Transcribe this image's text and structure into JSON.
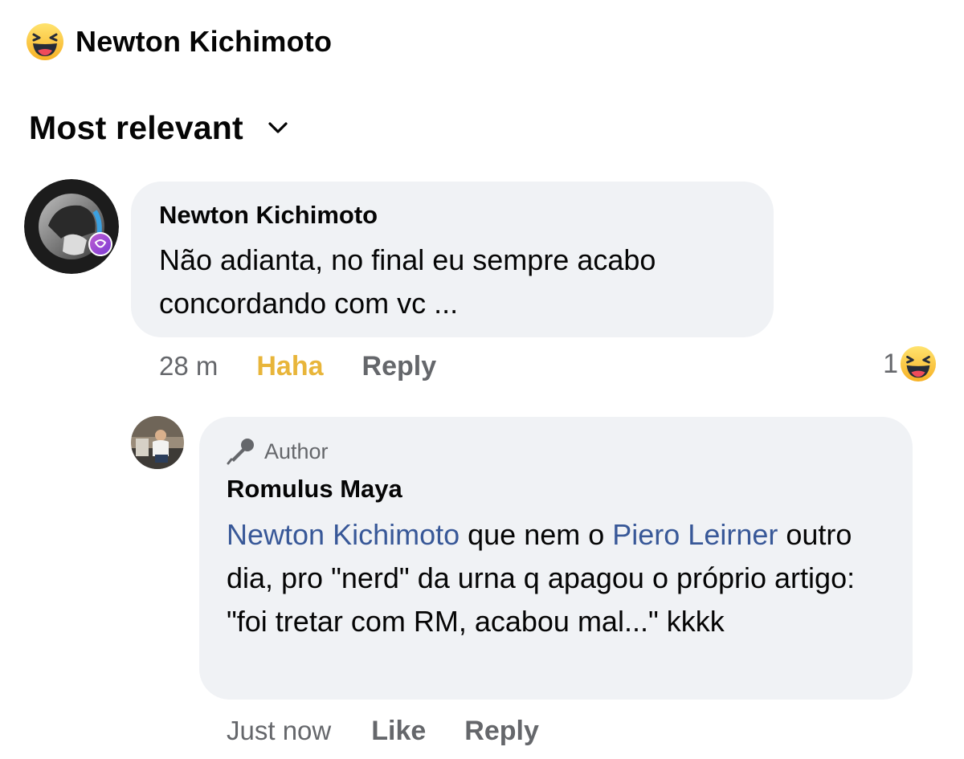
{
  "reactor": {
    "name": "Newton Kichimoto",
    "reaction_icon": "haha-emoji-icon"
  },
  "sort": {
    "label": "Most relevant",
    "icon": "chevron-down-icon"
  },
  "comments": [
    {
      "author": "Newton Kichimoto",
      "text": "Não adianta, no final eu sempre acabo concordando com vc ...",
      "time": "28 m",
      "reaction_label": "Haha",
      "reply_label": "Reply",
      "reaction_count": "1",
      "reaction_icon": "haha-emoji-icon"
    }
  ],
  "reply": {
    "badge": "Author",
    "author": "Romulus Maya",
    "mention1": "Newton Kichimoto",
    "text1": " que nem o ",
    "mention2": "Piero Leirner",
    "text2": " outro dia, pro \"nerd\" da urna q apagou o próprio artigo: \"foi tretar com RM, acabou mal...\" kkkk",
    "time": "Just now",
    "like_label": "Like",
    "reply_label": "Reply"
  },
  "colors": {
    "bubble": "#f0f2f5",
    "mention": "#385898",
    "haha": "#e8b53a",
    "muted": "#65676b"
  }
}
